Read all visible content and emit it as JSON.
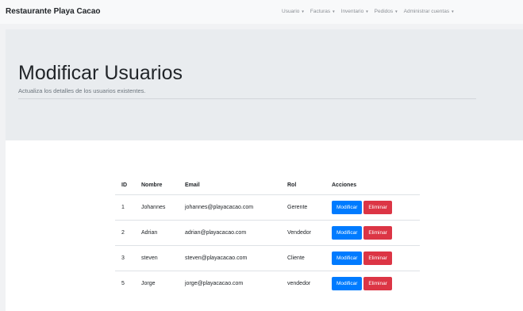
{
  "navbar": {
    "brand": "Restaurante Playa Cacao",
    "menu": [
      {
        "label": "Usuario"
      },
      {
        "label": "Facturas"
      },
      {
        "label": "Inventario"
      },
      {
        "label": "Pedidos"
      },
      {
        "label": "Administrar cuentas"
      }
    ]
  },
  "hero": {
    "title": "Modificar Usuarios",
    "subtitle": "Actualiza los detalles de los usuarios existentes."
  },
  "table": {
    "headers": [
      "ID",
      "Nombre",
      "Email",
      "Rol",
      "Acciones"
    ],
    "rows": [
      {
        "id": "1",
        "nombre": "Johannes",
        "email": "johannes@playacacao.com",
        "rol": "Gerente"
      },
      {
        "id": "2",
        "nombre": "Adrian",
        "email": "adrian@playacacao.com",
        "rol": "Vendedor"
      },
      {
        "id": "3",
        "nombre": "steven",
        "email": "steven@playacacao.com",
        "rol": "Cliente"
      },
      {
        "id": "5",
        "nombre": "Jorge",
        "email": "jorge@playacacao.com",
        "rol": "vendedor"
      }
    ],
    "actions": {
      "modify": "Modificar",
      "delete": "Eliminar"
    }
  },
  "colors": {
    "primary": "#007bff",
    "danger": "#dc3545",
    "jumbotron": "#e9ecef",
    "navbar": "#f8f9fa"
  }
}
